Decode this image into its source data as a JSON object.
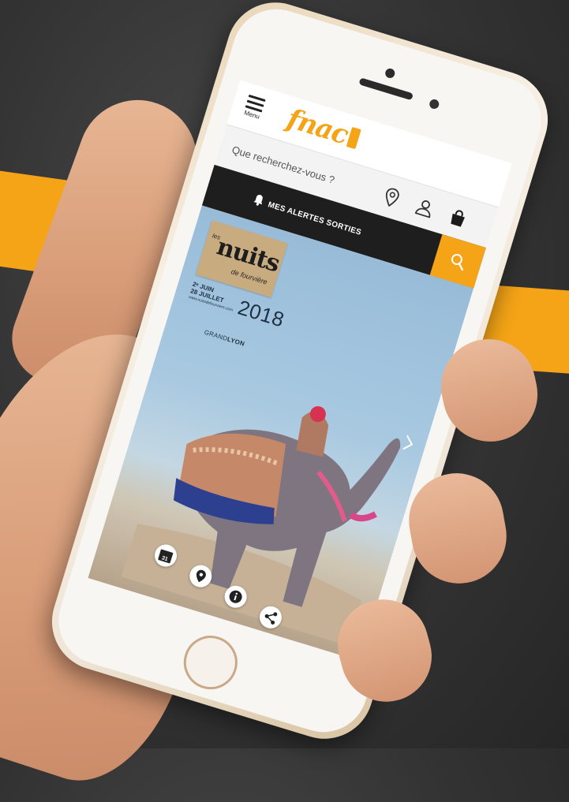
{
  "header": {
    "menu_label": "Menu",
    "logo_text": "fnac",
    "brand_color": "#f4a416"
  },
  "search": {
    "placeholder": "Que recherchez-vous ?",
    "icons": [
      "location-pin-icon",
      "user-icon",
      "shopping-bag-icon",
      "search-icon"
    ]
  },
  "alerts": {
    "label": "MES ALERTES SORTIES",
    "icon": "bell-icon"
  },
  "banner": {
    "logo_les": "les",
    "logo_title": "nuits",
    "logo_subtitle": "de fourvière",
    "date_start": "2ᵉ JUIN",
    "date_end": "28 JUILLET",
    "url": "www.nuitsdefourviere.com",
    "year": "2018",
    "sponsor_prefix": "GRAND",
    "sponsor_suffix": "LYON"
  },
  "actions": {
    "calendar_day": "31",
    "items": [
      "calendar-icon",
      "map-pin-icon",
      "info-icon",
      "share-icon"
    ]
  }
}
